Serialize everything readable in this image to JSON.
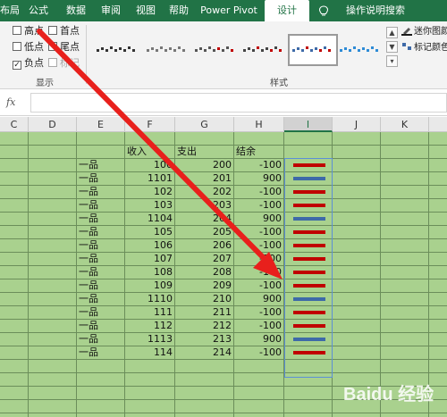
{
  "tabs": [
    {
      "label": "布局",
      "active": false
    },
    {
      "label": "公式",
      "active": false
    },
    {
      "label": "数据",
      "active": false
    },
    {
      "label": "审阅",
      "active": false
    },
    {
      "label": "视图",
      "active": false
    },
    {
      "label": "帮助",
      "active": false
    },
    {
      "label": "Power Pivot",
      "active": false
    },
    {
      "label": "设计",
      "active": true
    },
    {
      "label": "操作说明搜索",
      "active": false
    }
  ],
  "show_group": {
    "label": "显示",
    "checkboxes": [
      {
        "label": "高点",
        "checked": false
      },
      {
        "label": "首点",
        "checked": false
      },
      {
        "label": "低点",
        "checked": false
      },
      {
        "label": "尾点",
        "checked": false
      },
      {
        "label": "负点",
        "checked": true
      },
      {
        "label": "标记",
        "checked": false
      }
    ]
  },
  "style_group": {
    "label": "样式",
    "selected_index": 4
  },
  "side_commands": {
    "sparkline_color": "迷你图颜",
    "marker_color": "标记颜色"
  },
  "formula_bar": {
    "fx_label": "fx",
    "value": ""
  },
  "columns": [
    "C",
    "D",
    "E",
    "F",
    "G",
    "H",
    "I",
    "J",
    "K"
  ],
  "selected_column": "I",
  "table": {
    "headers": {
      "income": "收入",
      "expense": "支出",
      "balance": "结余"
    },
    "rows": [
      {
        "item": "一品",
        "income": "100",
        "expense": "200",
        "balance": "-100"
      },
      {
        "item": "一品",
        "income": "1101",
        "expense": "201",
        "balance": "900"
      },
      {
        "item": "一品",
        "income": "102",
        "expense": "202",
        "balance": "-100"
      },
      {
        "item": "一品",
        "income": "103",
        "expense": "203",
        "balance": "-100"
      },
      {
        "item": "一品",
        "income": "1104",
        "expense": "204",
        "balance": "900"
      },
      {
        "item": "一品",
        "income": "105",
        "expense": "205",
        "balance": "-100"
      },
      {
        "item": "一品",
        "income": "106",
        "expense": "206",
        "balance": "-100"
      },
      {
        "item": "一品",
        "income": "107",
        "expense": "207",
        "balance": "-100"
      },
      {
        "item": "一品",
        "income": "108",
        "expense": "208",
        "balance": "-100"
      },
      {
        "item": "一品",
        "income": "109",
        "expense": "209",
        "balance": "-100"
      },
      {
        "item": "一品",
        "income": "1110",
        "expense": "210",
        "balance": "900"
      },
      {
        "item": "一品",
        "income": "111",
        "expense": "211",
        "balance": "-100"
      },
      {
        "item": "一品",
        "income": "112",
        "expense": "212",
        "balance": "-100"
      },
      {
        "item": "一品",
        "income": "1113",
        "expense": "213",
        "balance": "900"
      },
      {
        "item": "一品",
        "income": "114",
        "expense": "214",
        "balance": "-100"
      }
    ]
  },
  "colors": {
    "accent": "#217346",
    "grid_fill": "#a9d18e",
    "negative_point": "#c00000",
    "positive_point": "#3e6aa8",
    "arrow": "#e8201c"
  },
  "watermark": "Baidu 经验"
}
